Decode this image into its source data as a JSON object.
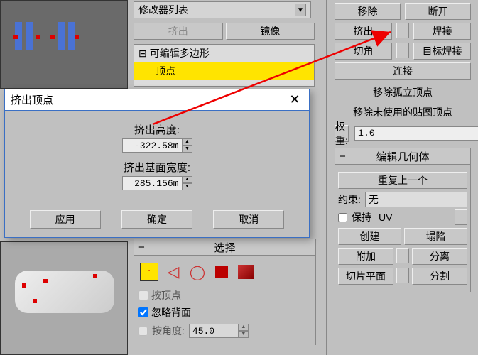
{
  "mid": {
    "dropdown": "修改器列表",
    "btn_extrude": "挤出",
    "btn_mirror": "镜像",
    "tree_parent": "可编辑多边形",
    "tree_child": "顶点",
    "sel_header": "选择",
    "chk_byvertex": "按顶点",
    "chk_ignoreback": "忽略背面",
    "lbl_angle": "按角度:",
    "val_angle": "45.0"
  },
  "right": {
    "btn_remove": "移除",
    "btn_break": "断开",
    "btn_extrude": "挤出",
    "btn_weld": "焊接",
    "btn_chamfer": "切角",
    "btn_targetweld": "目标焊接",
    "btn_connect": "连接",
    "lbl_removeiso": "移除孤立顶点",
    "lbl_removeunused": "移除未使用的贴图顶点",
    "btn_weight": "权重:",
    "val_weight": "1.0",
    "rollout_editgeo": "编辑几何体",
    "btn_repeat": "重复上一个",
    "lbl_constraint": "约束:",
    "val_constraint": "无",
    "chk_preserve": "保持",
    "lbl_uv": "UV",
    "btn_create": "创建",
    "btn_collapse": "塌陷",
    "btn_attach": "附加",
    "btn_detach": "分离",
    "btn_sliceplane": "切片平面",
    "btn_split": "分割"
  },
  "dialog": {
    "title": "挤出顶点",
    "lbl_height": "挤出高度:",
    "val_height": "-322.58m",
    "lbl_width": "挤出基面宽度:",
    "val_width": "285.156m",
    "btn_apply": "应用",
    "btn_ok": "确定",
    "btn_cancel": "取消"
  }
}
